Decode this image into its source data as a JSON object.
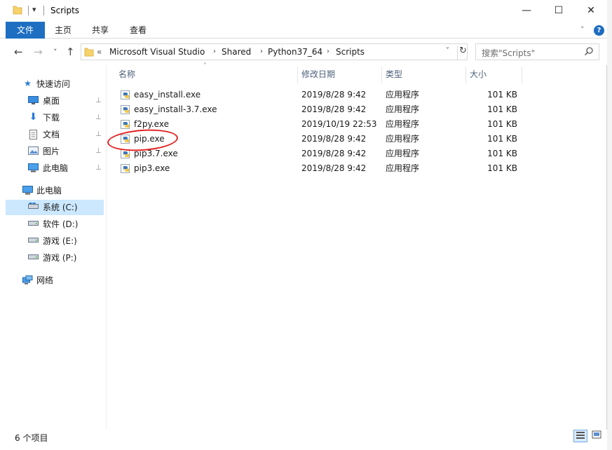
{
  "window": {
    "title": "Scripts",
    "quick_access_glyph": "▾",
    "minimize_glyph": "—",
    "maximize_glyph": "☐",
    "close_glyph": "✕"
  },
  "ribbon": {
    "tabs": [
      {
        "label": "文件"
      },
      {
        "label": "主页"
      },
      {
        "label": "共享"
      },
      {
        "label": "查看"
      }
    ],
    "expand_glyph": "˅",
    "help_glyph": "?"
  },
  "nav_buttons": {
    "back": "←",
    "forward": "→",
    "recent": "˅",
    "up": "↑"
  },
  "address": {
    "overflow": "«",
    "crumbs": [
      "Microsoft Visual Studio",
      "Shared",
      "Python37_64",
      "Scripts"
    ],
    "separator": "›",
    "dropdown_glyph": "˅",
    "refresh_glyph": "↻"
  },
  "search": {
    "placeholder": "搜索\"Scripts\"",
    "icon": "search-icon"
  },
  "navpane": {
    "items": [
      {
        "label": "快速访问",
        "icon": "star-icon"
      },
      {
        "label": "桌面",
        "icon": "desktop-icon",
        "pinned": true
      },
      {
        "label": "下载",
        "icon": "download-icon",
        "pinned": true
      },
      {
        "label": "文档",
        "icon": "document-icon",
        "pinned": true
      },
      {
        "label": "图片",
        "icon": "picture-icon",
        "pinned": true
      },
      {
        "label": "此电脑",
        "icon": "computer-icon",
        "pinned": true
      },
      {
        "label": "此电脑",
        "icon": "computer-icon"
      },
      {
        "label": "系统 (C:)",
        "icon": "drive-icon"
      },
      {
        "label": "软件 (D:)",
        "icon": "drive-icon"
      },
      {
        "label": "游戏 (E:)",
        "icon": "drive-icon"
      },
      {
        "label": "游戏 (P:)",
        "icon": "drive-icon"
      },
      {
        "label": "网络",
        "icon": "network-icon"
      }
    ],
    "pin_glyph": "📌"
  },
  "columns": {
    "name": "名称",
    "modified": "修改日期",
    "type": "类型",
    "size": "大小",
    "sort_glyph": "˄"
  },
  "files": [
    {
      "name": "easy_install.exe",
      "modified": "2019/8/28 9:42",
      "type": "应用程序",
      "size": "101 KB"
    },
    {
      "name": "easy_install-3.7.exe",
      "modified": "2019/8/28 9:42",
      "type": "应用程序",
      "size": "101 KB"
    },
    {
      "name": "f2py.exe",
      "modified": "2019/10/19 22:53",
      "type": "应用程序",
      "size": "101 KB"
    },
    {
      "name": "pip.exe",
      "modified": "2019/8/28 9:42",
      "type": "应用程序",
      "size": "101 KB"
    },
    {
      "name": "pip3.7.exe",
      "modified": "2019/8/28 9:42",
      "type": "应用程序",
      "size": "101 KB"
    },
    {
      "name": "pip3.exe",
      "modified": "2019/8/28 9:42",
      "type": "应用程序",
      "size": "101 KB"
    }
  ],
  "status": {
    "item_count": "6 个项目"
  },
  "colors": {
    "accent": "#1e6fc2",
    "selection": "#cce8ff",
    "annotation_circle": "#e32222",
    "column_header": "#4c607a"
  }
}
